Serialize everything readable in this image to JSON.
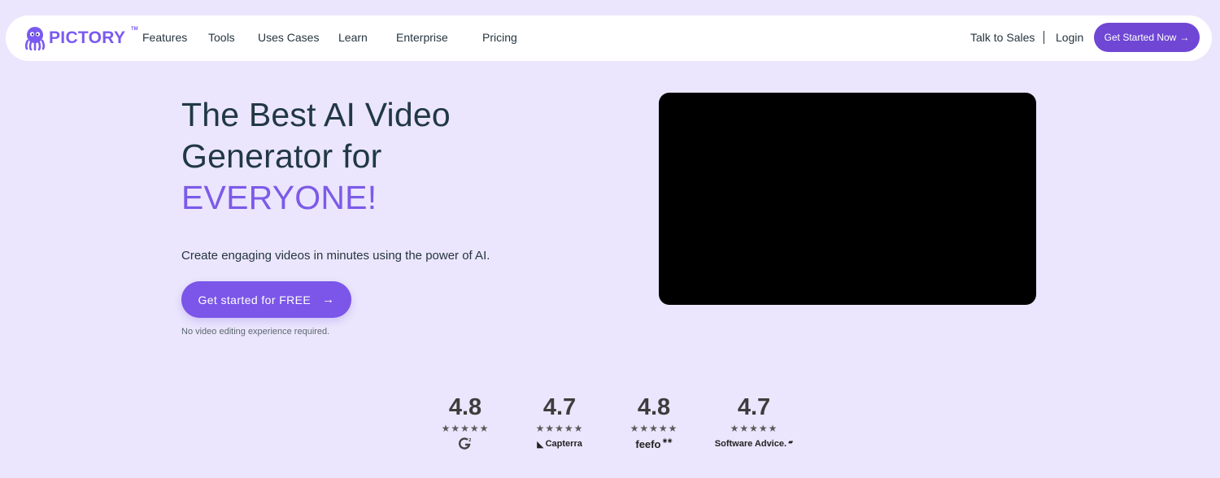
{
  "brand": {
    "name": "PICTORY",
    "tm": "TM",
    "color": "#7a5af0"
  },
  "nav": {
    "links": [
      "Features",
      "Tools",
      "Uses Cases",
      "Learn",
      "Enterprise",
      "Pricing"
    ],
    "talk_to_sales": "Talk to Sales",
    "login": "Login",
    "cta": "Get Started Now",
    "cta_color": "#6f47d4"
  },
  "hero": {
    "title_line1": "The Best AI Video",
    "title_line2": "Generator for",
    "title_accent": "EVERYONE!",
    "accent_color": "#7c5ae8",
    "subtitle": "Create engaging videos in minutes using the power of AI.",
    "cta": "Get started for FREE",
    "note": "No video editing experience required."
  },
  "video": {
    "icon": "video-player"
  },
  "ratings": [
    {
      "score": "4.8",
      "stars": "★★★★★",
      "source": "G2",
      "logo": ""
    },
    {
      "score": "4.7",
      "stars": "★★★★★",
      "source": "Capterra",
      "logo": "Capterra"
    },
    {
      "score": "4.8",
      "stars": "★★★★★",
      "source": "feefo",
      "logo": "feefo"
    },
    {
      "score": "4.7",
      "stars": "★★★★★",
      "source": "Software Advice",
      "logo": "Software Advice."
    }
  ]
}
